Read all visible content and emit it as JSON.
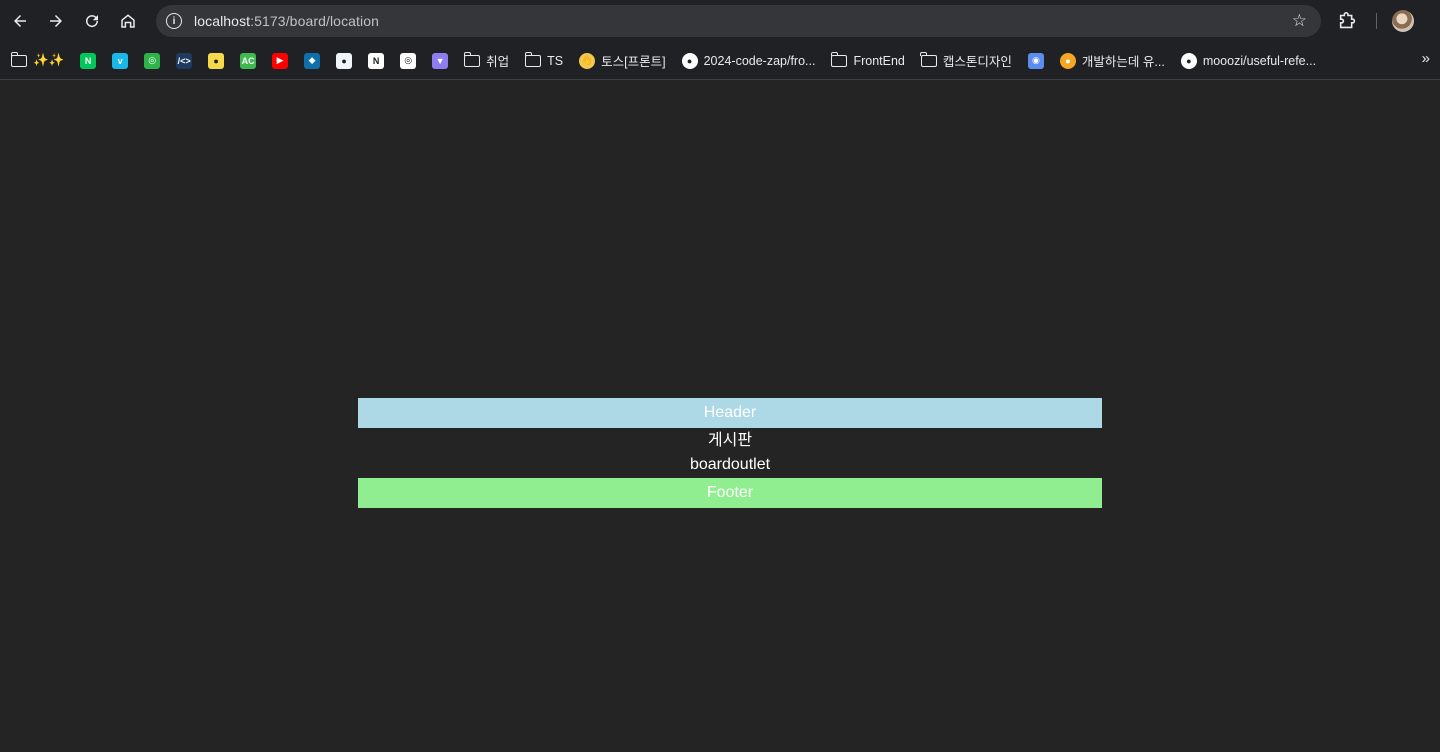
{
  "browser": {
    "url_host": "localhost",
    "url_path": ":5173/board/location",
    "star_icon": "star-icon",
    "extensions_icon": "puzzle-icon"
  },
  "bookmarks": [
    {
      "type": "folder",
      "label": "✨✨"
    },
    {
      "type": "fav",
      "glyph": "N",
      "color": "#03c75a"
    },
    {
      "type": "fav",
      "glyph": "v",
      "color": "#1ab7ea"
    },
    {
      "type": "fav",
      "glyph": "◎",
      "color": "#2db34a"
    },
    {
      "type": "fav",
      "glyph": "/<>",
      "color": "#1e3a5f"
    },
    {
      "type": "fav",
      "glyph": "●",
      "color": "#f7d94c"
    },
    {
      "type": "fav",
      "glyph": "AC",
      "color": "#3fb950"
    },
    {
      "type": "fav",
      "glyph": "▶",
      "color": "#ff0000"
    },
    {
      "type": "fav",
      "glyph": "◆",
      "color": "#0f6fa8"
    },
    {
      "type": "fav",
      "glyph": "●",
      "color": "#f0f6fc"
    },
    {
      "type": "fav",
      "glyph": "N",
      "color": "#ffffff"
    },
    {
      "type": "fav",
      "glyph": "◎",
      "color": "#ffffff"
    },
    {
      "type": "fav",
      "glyph": "▼",
      "color": "#8e7cf1"
    },
    {
      "type": "folder",
      "label": "취업"
    },
    {
      "type": "folder",
      "label": "TS"
    },
    {
      "type": "fav-label",
      "glyph": "👋",
      "color": "#f2c94c",
      "label": "토스[프론트]"
    },
    {
      "type": "fav-label",
      "glyph": "●",
      "color": "#ffffff",
      "label": "2024-code-zap/fro..."
    },
    {
      "type": "folder",
      "label": "FrontEnd"
    },
    {
      "type": "folder",
      "label": "캡스톤디자인"
    },
    {
      "type": "fav",
      "glyph": "◉",
      "color": "#5b8def"
    },
    {
      "type": "fav-label",
      "glyph": "●",
      "color": "#f5a623",
      "label": "개발하는데 유..."
    },
    {
      "type": "fav-label",
      "glyph": "●",
      "color": "#ffffff",
      "label": "mooozi/useful-refe..."
    }
  ],
  "bookmarks_more": "»",
  "app": {
    "header_text": "Header",
    "page_title": "게시판",
    "outlet_text": "boardoutlet",
    "footer_text": "Footer",
    "header_color": "#add8e6",
    "footer_color": "#90ee90"
  }
}
